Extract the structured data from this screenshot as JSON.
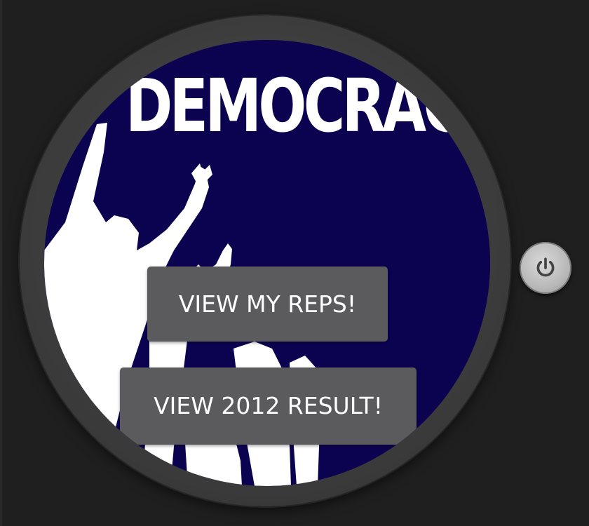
{
  "screen": {
    "headline": "DEMOCRACY",
    "background_color": "#0b0350"
  },
  "buttons": {
    "view_reps_label": "VIEW MY REPS!",
    "view_result_label": "VIEW 2012 RESULT!"
  },
  "hardware": {
    "power_icon": "power-icon"
  }
}
